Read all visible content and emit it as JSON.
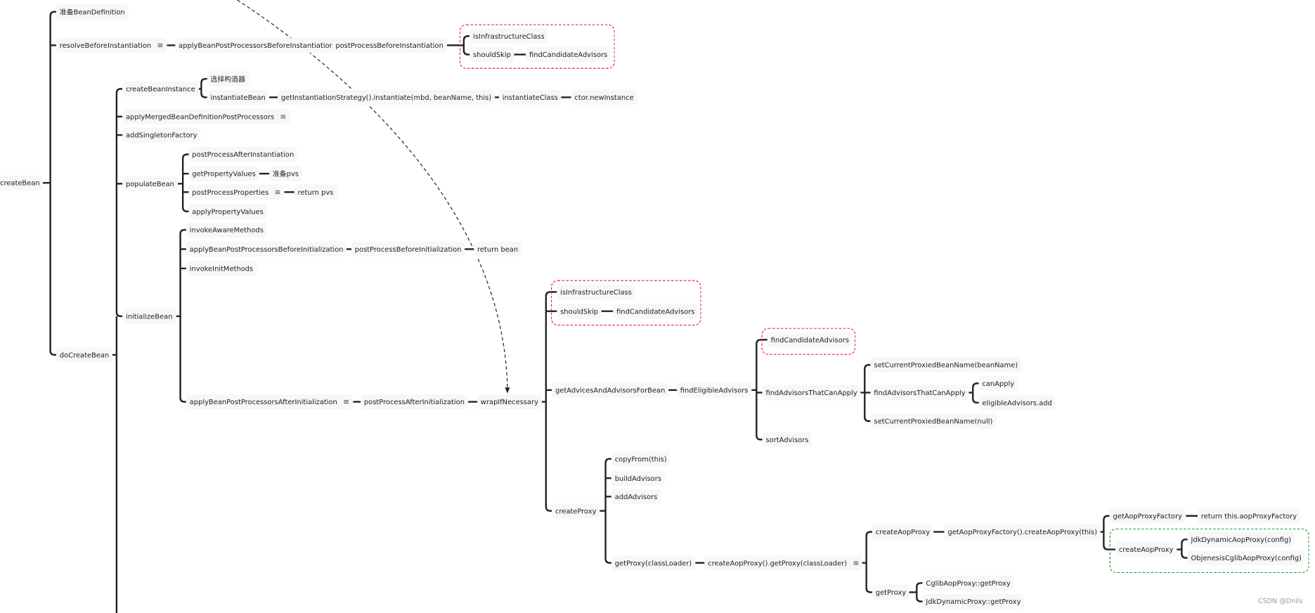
{
  "nodes": {
    "createBean": "createBean",
    "prepareBeanDefinition": "准备BeanDefinition",
    "resolveBeforeInstantiation": "resolveBeforeInstantiation",
    "applyBPPBeforeInstantiation": "applyBeanPostProcessorsBeforeInstantiation",
    "postProcessBeforeInstantiation": "postProcessBeforeInstantiation",
    "isInfrastructureClass1": "isInfrastructureClass",
    "shouldSkip1": "shouldSkip",
    "findCandidateAdvisors1": "findCandidateAdvisors",
    "doCreateBean": "doCreateBean",
    "createBeanInstance": "createBeanInstance",
    "chooseConstructor": "选择构造器",
    "instantiateBean": "instantiateBean",
    "getInstantiationStrategy": "getInstantiationStrategy().instantiate(mbd, beanName, this)",
    "instantiateClass": "instantiateClass",
    "ctorNewInstance": "ctor.newInstance",
    "applyMergedBDPP": "applyMergedBeanDefinitionPostProcessors",
    "addSingletonFactory": "addSingletonFactory",
    "populateBean": "populateBean",
    "postProcessAfterInstantiation": "postProcessAfterInstantiation",
    "getPropertyValues": "getPropertyValues",
    "preparePvs": "准备pvs",
    "postProcessProperties": "postProcessProperties",
    "returnPvs": "return pvs",
    "applyPropertyValues": "applyPropertyValues",
    "initializeBean": "initializeBean",
    "invokeAwareMethods": "invokeAwareMethods",
    "applyBPPBeforeInitialization": "applyBeanPostProcessorsBeforeInitialization",
    "postProcessBeforeInitialization": "postProcessBeforeInitialization",
    "returnBean": "return bean",
    "invokeInitMethods": "invokeInitMethods",
    "applyBPPAfterInitialization": "applyBeanPostProcessorsAfterInitialization",
    "postProcessAfterInitialization": "postProcessAfterInitialization",
    "wrapIfNecessary": "wrapIfNecessary",
    "isInfrastructureClass2": "isInfrastructureClass",
    "shouldSkip2": "shouldSkip",
    "findCandidateAdvisors2": "findCandidateAdvisors",
    "getAdvicesAndAdvisorsForBean": "getAdvicesAndAdvisorsForBean",
    "findEligibleAdvisors": "findEligibleAdvisors",
    "findCandidateAdvisors3": "findCandidateAdvisors",
    "findAdvisorsThatCanApply1": "findAdvisorsThatCanApply",
    "setCurrentProxiedBeanName": "setCurrentProxiedBeanName(beanName)",
    "findAdvisorsThatCanApply2": "findAdvisorsThatCanApply",
    "canApply": "canApply",
    "eligibleAdvisorsAdd": "eligibleAdvisors.add",
    "setCurrentProxiedBeanNameNull": "setCurrentProxiedBeanName(null)",
    "sortAdvisors": "sortAdvisors",
    "createProxy": "createProxy",
    "copyFrom": "copyFrom(this)",
    "buildAdvisors": "buildAdvisors",
    "addAdvisors": "addAdvisors",
    "getProxyClassLoader": "getProxy(classLoader)",
    "createAopProxyGetProxy": "createAopProxy().getProxy(classLoader)",
    "createAopProxy1": "createAopProxy",
    "getAopProxyFactoryCreate": "getAopProxyFactory().createAopProxy(this)",
    "getAopProxyFactory": "getAopProxyFactory",
    "returnAopProxyFactory": "return this.aopProxyFactory",
    "createAopProxy2": "createAopProxy",
    "jdkDynamicAopProxy": "JdkDynamicAopProxy(config)",
    "objenesisCglibAopProxy": "ObjenesisCglibAopProxy(config)",
    "getProxy": "getProxy",
    "cglibGetProxy": "CglibAopProxy::getProxy",
    "jdkGetProxy": "JdkDynamicProxy::getProxy"
  },
  "note_icon": "menu-lines-icon",
  "colors": {
    "highlight_red": "#f01e2c",
    "highlight_green": "#1f9a2e",
    "line": "#222222",
    "node_bg": "#f7f7f7"
  },
  "watermark": "CSDN @Dnils"
}
